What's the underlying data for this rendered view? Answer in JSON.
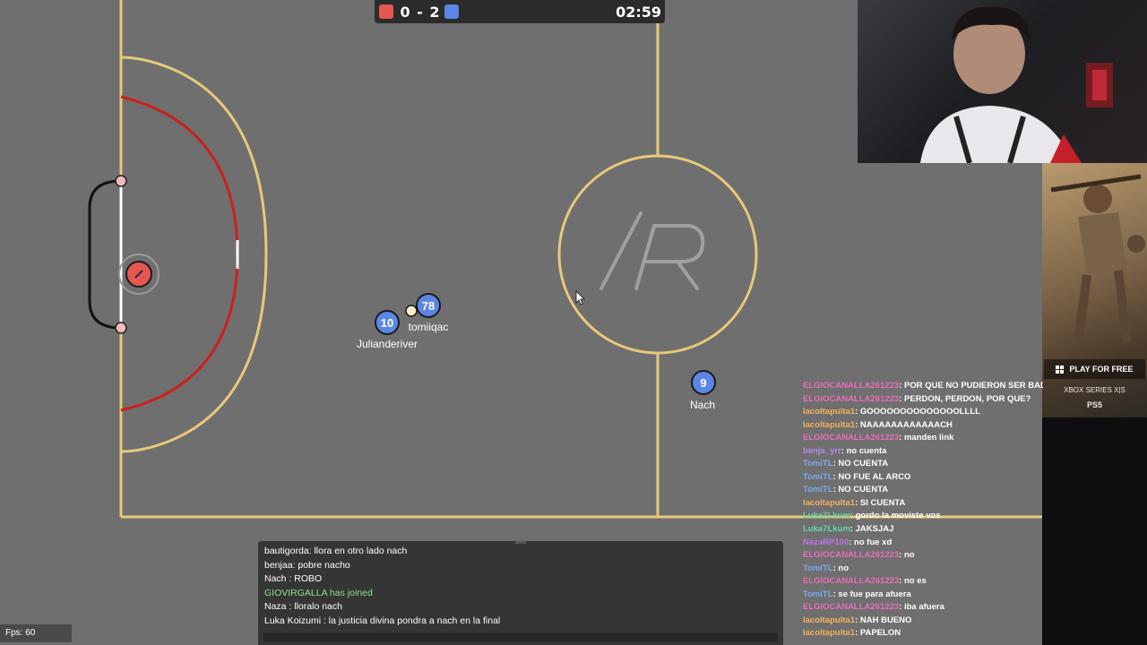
{
  "scoreboard": {
    "red_score": 0,
    "blue_score": 2,
    "score_text": "0 - 2",
    "time": "02:59",
    "red_color": "#e5584f",
    "blue_color": "#5b86e5"
  },
  "field": {
    "line_color": "#e8c979",
    "area_color": "#cc1f1f",
    "logo_text": "/R"
  },
  "players": [
    {
      "number": "10",
      "name": "Julianderiver",
      "team": "blue",
      "side": "left"
    },
    {
      "number": "78",
      "name": "tomiiqac",
      "team": "blue",
      "side": "right"
    },
    {
      "number": "9",
      "name": "Nach",
      "team": "blue",
      "side": "right"
    },
    {
      "number": "",
      "name": "",
      "team": "red",
      "role": "goalkeeper"
    }
  ],
  "ad": {
    "cta": "PLAY FOR FREE",
    "platform1": "XBOX SERIES X|S",
    "platform2": "PS5"
  },
  "twitch_chat": [
    {
      "user": "ELGIOCANALLA261223",
      "color": "#e86fb7",
      "text": "POR QUE NO PUDIERON SER BAD BUNNY"
    },
    {
      "user": "ELGIOCANALLA261223",
      "color": "#e86fb7",
      "text": "PERDON, PERDON, POR QUE?"
    },
    {
      "user": "lacoltapulta1",
      "color": "#f2b35a",
      "text": "GOOOOOOOOOOOOOOLLLL"
    },
    {
      "user": "lacoltapulta1",
      "color": "#f2b35a",
      "text": "NAAAAAAAAAAAACH"
    },
    {
      "user": "ELGIOCANALLA261223",
      "color": "#e86fb7",
      "text": "manden link"
    },
    {
      "user": "benja_yrr",
      "color": "#b58cf0",
      "text": "no cuenta"
    },
    {
      "user": "TomiTL",
      "color": "#7fa8f0",
      "text": "NO CUENTA"
    },
    {
      "user": "TomiTL",
      "color": "#7fa8f0",
      "text": "NO FUE AL ARCO"
    },
    {
      "user": "TomiTL",
      "color": "#7fa8f0",
      "text": "NO CUENTA"
    },
    {
      "user": "lacoltapulta1",
      "color": "#f2b35a",
      "text": "SI CUENTA"
    },
    {
      "user": "Luka7Lkum",
      "color": "#5fd8b0",
      "text": "gordo la moviste vos"
    },
    {
      "user": "Luka7Lkum",
      "color": "#5fd8b0",
      "text": "JAKSJAJ"
    },
    {
      "user": "NazaRP100",
      "color": "#c070f0",
      "text": "no fue xd"
    },
    {
      "user": "ELGIOCANALLA261223",
      "color": "#e86fb7",
      "text": "no"
    },
    {
      "user": "TomiTL",
      "color": "#7fa8f0",
      "text": "no"
    },
    {
      "user": "ELGIOCANALLA261223",
      "color": "#e86fb7",
      "text": "no es"
    },
    {
      "user": "TomiTL",
      "color": "#7fa8f0",
      "text": "se fue para afuera"
    },
    {
      "user": "ELGIOCANALLA261223",
      "color": "#e86fb7",
      "text": "iba afuera"
    },
    {
      "user": "lacoltapulta1",
      "color": "#f2b35a",
      "text": "NAH BUENO"
    },
    {
      "user": "lacoltapulta1",
      "color": "#f2b35a",
      "text": "PAPELON"
    }
  ],
  "game_chat": [
    {
      "text": "bautigorda: llora en otro lado nach",
      "color": "#ffffff"
    },
    {
      "text": "benjaa: pobre nacho",
      "color": "#ffffff"
    },
    {
      "text": "Nach : ROBO",
      "color": "#ffffff"
    },
    {
      "text": "GIOVIRGALLA has joined",
      "color": "#8ee08e"
    },
    {
      "text": "Naza : lloralo nach",
      "color": "#ffffff"
    },
    {
      "text": "Luka Koizumi : la justicia divina pondra a nach en la final",
      "color": "#ffffff"
    }
  ],
  "fps": "Fps: 60"
}
